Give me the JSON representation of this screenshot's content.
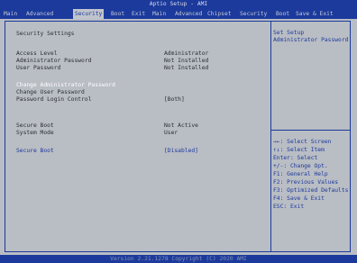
{
  "app_title": "Aptio Setup - AMI",
  "tabs": [
    {
      "label": "Main"
    },
    {
      "label": "Advanced"
    },
    {
      "label": "Security"
    },
    {
      "label": "Boot"
    },
    {
      "label": "Exit"
    },
    {
      "label": "Main"
    },
    {
      "label": "Advanced"
    },
    {
      "label": "Chipset"
    },
    {
      "label": "Security"
    },
    {
      "label": "Boot"
    },
    {
      "label": "Save & Exit"
    }
  ],
  "section_title": "Security Settings",
  "access_level": {
    "label": "Access Level",
    "value": "Administrator"
  },
  "admin_password": {
    "label": "Administrator Password",
    "value": "Not Installed"
  },
  "user_password": {
    "label": "User Password",
    "value": "Not Installed"
  },
  "change_admin_password": "Change Administrator Password",
  "change_user_password": "Change User Password",
  "password_login_control": {
    "label": "Password Login Control",
    "value": "[Both]"
  },
  "secure_boot_status": {
    "label": "Secure Boot",
    "value": "Not Active"
  },
  "system_mode": {
    "label": "System Mode",
    "value": "User"
  },
  "secure_boot_option": {
    "label": "Secure Boot",
    "value": "[Disabled]"
  },
  "help_text": [
    "Set Setup",
    "Administrator Password"
  ],
  "key_help": [
    "→←: Select Screen",
    "↑↓: Select Item",
    "Enter: Select",
    "+/-: Change Opt.",
    "F1: General Help",
    "F2: Previous Values",
    "F3: Optimized Defaults",
    "F4: Save & Exit",
    "ESC: Exit"
  ],
  "footer": "Version 2.21.1278 Copyright (C) 2020 AMI",
  "colors": {
    "accent": "#1c3a9c",
    "panel": "#b9bdc4",
    "highlight": "#ffffff"
  }
}
